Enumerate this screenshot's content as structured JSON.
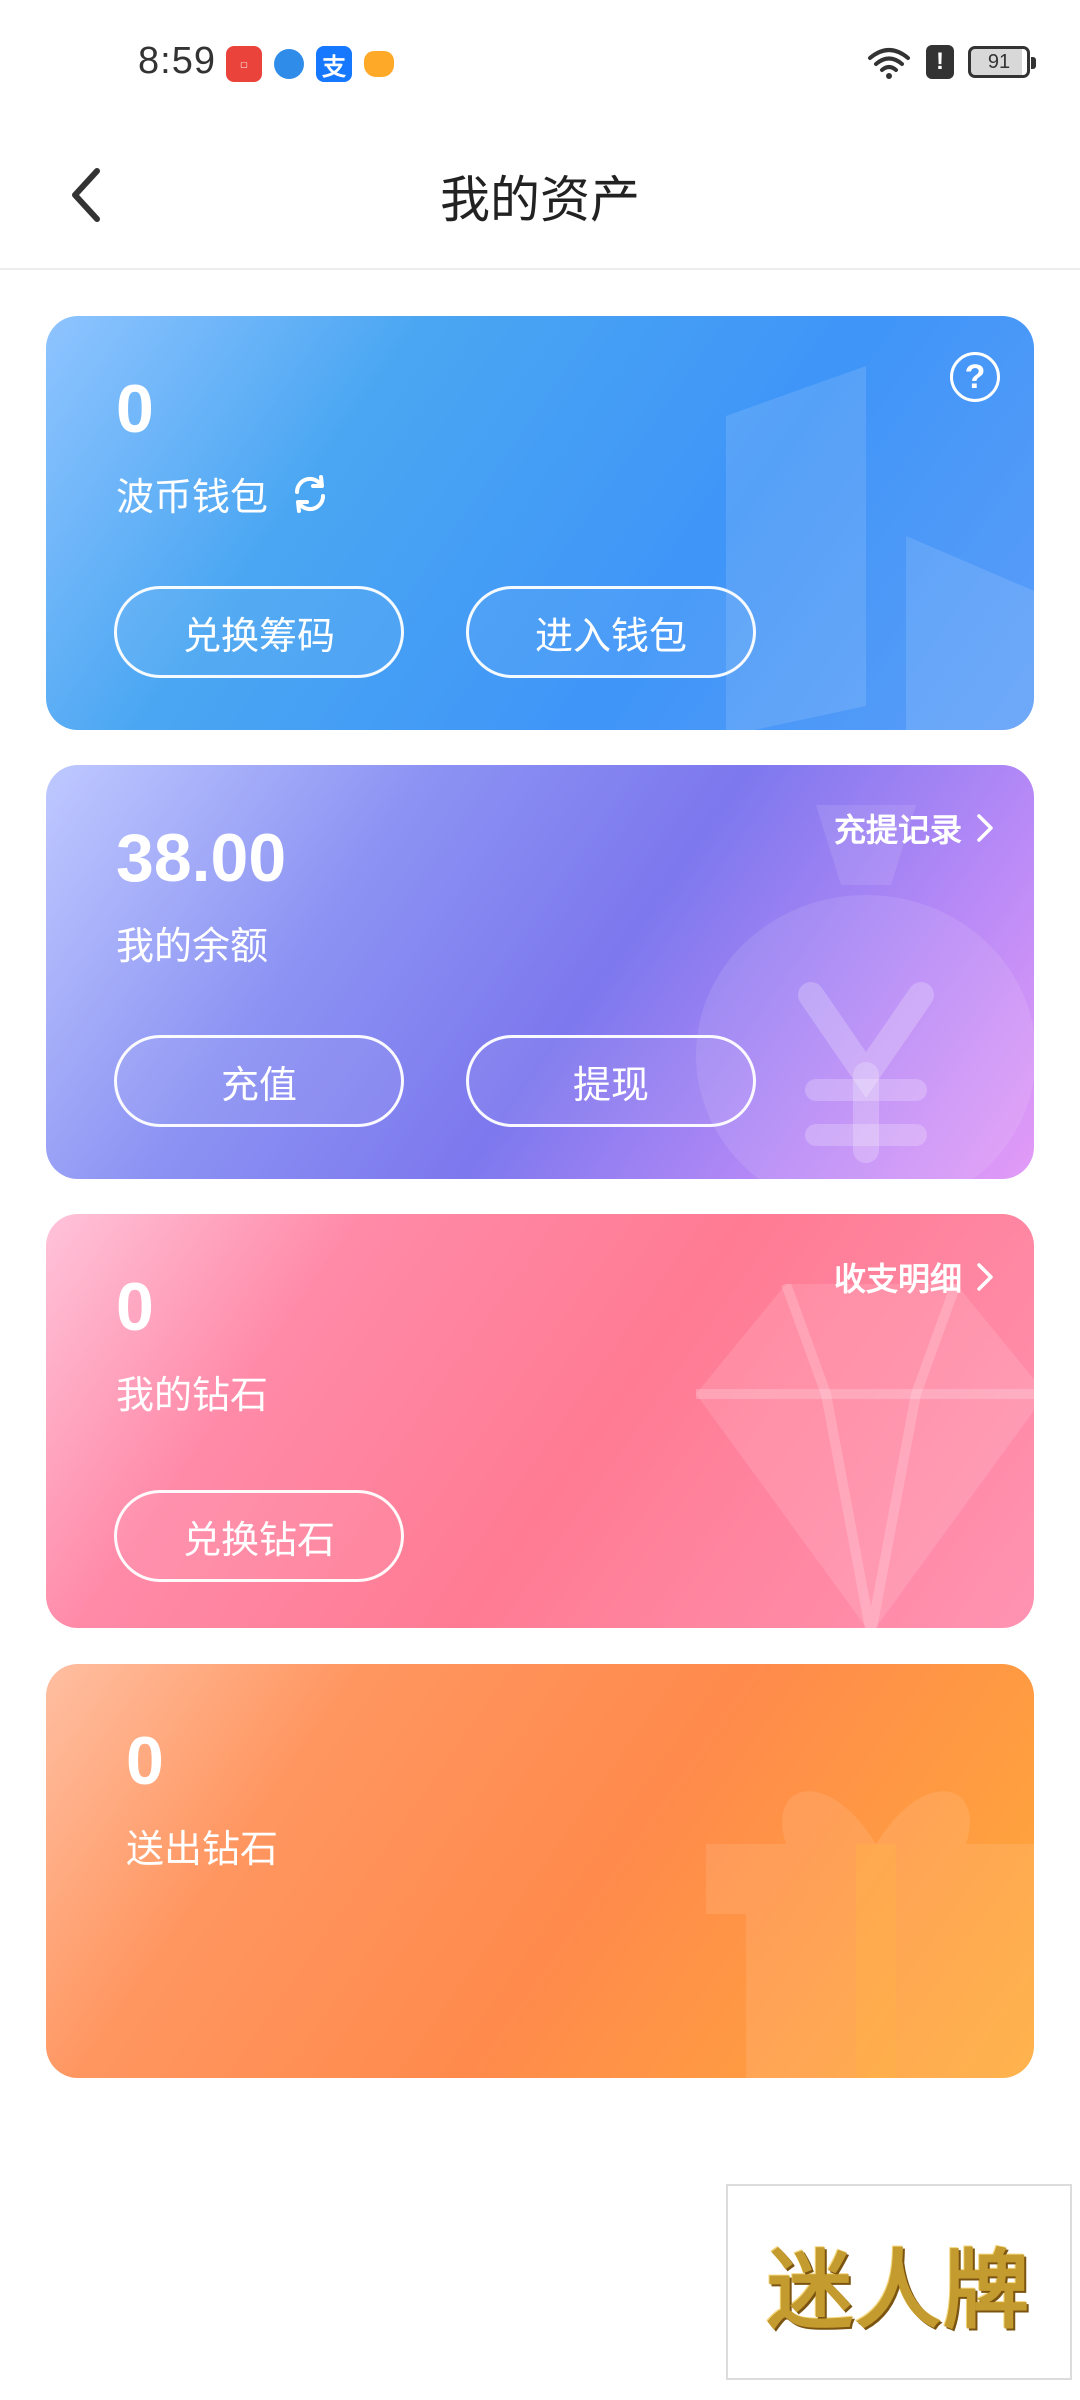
{
  "status_bar": {
    "time": "8:59",
    "battery": "91",
    "alert": "!"
  },
  "nav": {
    "title": "我的资产"
  },
  "wallet_card": {
    "amount": "0",
    "label": "波币钱包",
    "help": "?",
    "btn_exchange": "兑换筹码",
    "btn_enter": "进入钱包"
  },
  "balance_card": {
    "amount": "38.00",
    "label": "我的余额",
    "link": "充提记录",
    "btn_recharge": "充值",
    "btn_withdraw": "提现"
  },
  "diamond_card": {
    "amount": "0",
    "label": "我的钻石",
    "link": "收支明细",
    "btn_exchange": "兑换钻石"
  },
  "sent_card": {
    "amount": "0",
    "label": "送出钻石"
  },
  "watermark": {
    "text": "迷人牌"
  },
  "colors": {
    "wallet": "#3f95f8",
    "balance": "#7d78ee",
    "diamond": "#ff7b93",
    "sent": "#ff8a4c"
  }
}
